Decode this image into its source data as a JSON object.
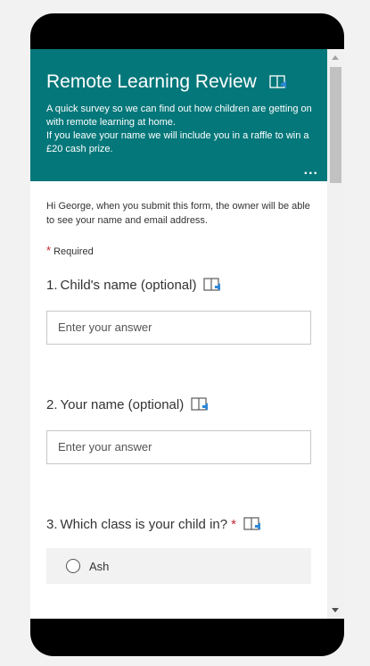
{
  "form": {
    "title": "Remote Learning Review",
    "description_lines": [
      "A quick survey so we can find out how children are getting on with remote learning at home.",
      "If you leave your name we will include you in a raffle to win a £20 cash prize."
    ],
    "more_label": "...",
    "notice": "Hi George, when you submit this form, the owner will be able to see your name and email address.",
    "required_star": "*",
    "required_label": "Required"
  },
  "questions": [
    {
      "number": "1.",
      "title": "Child's name (optional)",
      "placeholder": "Enter your answer"
    },
    {
      "number": "2.",
      "title": "Your name (optional)",
      "placeholder": "Enter your answer"
    },
    {
      "number": "3.",
      "title": "Which class is your child in?",
      "required_star": "*",
      "options": [
        "Ash"
      ]
    }
  ],
  "colors": {
    "header_bg": "#04777a",
    "required_red": "#c4262e"
  },
  "icons": {
    "immersive_reader": "immersive-reader-icon",
    "more": "more-options-icon",
    "radio": "radio-button-icon"
  }
}
